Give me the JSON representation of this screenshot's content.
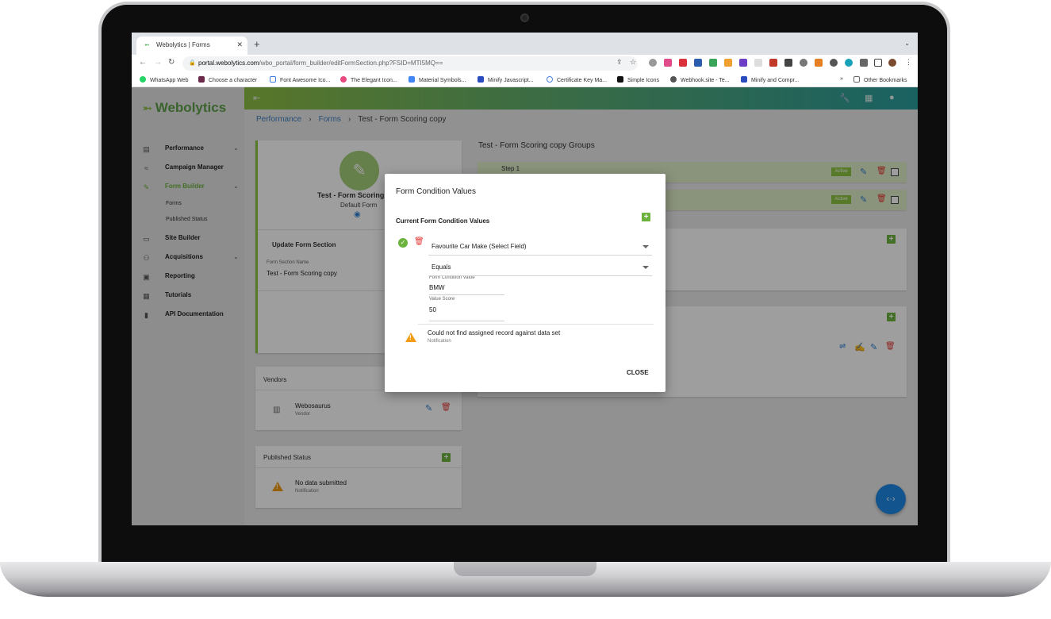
{
  "browser": {
    "tab_title": "Webolytics | Forms",
    "url_host": "portal.webolytics.com",
    "url_path": "/wbo_portal/form_builder/editFormSection.php?FSID=MTI5MQ==",
    "bookmarks": [
      "WhatsApp Web",
      "Choose a character",
      "Font Awesome Ico...",
      "The Elegant Icon...",
      "Material Symbols...",
      "Minify Javascript...",
      "Certificate Key Ma...",
      "Simple Icons",
      "Webhook.site - Te...",
      "Minify and Compr..."
    ],
    "more_bookmarks": "»",
    "other_bookmarks": "Other Bookmarks"
  },
  "app": {
    "logo": "Webolytics",
    "nav": {
      "performance": "Performance",
      "campaign_manager": "Campaign Manager",
      "form_builder": "Form Builder",
      "forms": "Forms",
      "published_status": "Published Status",
      "site_builder": "Site Builder",
      "acquisitions": "Acquisitions",
      "reporting": "Reporting",
      "tutorials": "Tutorials",
      "api_documentation": "API Documentation"
    },
    "breadcrumb": [
      "Performance",
      "Forms",
      "Test - Form Scoring copy"
    ],
    "form_card": {
      "title": "Test - Form Scoring copy",
      "subtitle": "Default Form"
    },
    "update_section": {
      "title": "Update Form Section",
      "field_label": "Form Section Name",
      "field_value": "Test - Form Scoring copy"
    },
    "vendors": {
      "title": "Vendors",
      "name": "Webosaurus",
      "role": "Vendor"
    },
    "published_status": {
      "title": "Published Status",
      "message": "No data submitted",
      "caption": "Notification"
    },
    "groups": {
      "title": "Test - Form Scoring copy Groups",
      "step_label": "Step 1",
      "badge": "Active"
    }
  },
  "dialog": {
    "title": "Form Condition Values",
    "subtitle": "Current Form Condition Values",
    "field_select": "Favourite Car Make (Select Field)",
    "operator_select": "Equals",
    "value_label": "Form Condition Value",
    "value": "BMW",
    "score_label": "Value Score",
    "score": "50",
    "warning_message": "Could not find assigned record against data set",
    "warning_caption": "Notification",
    "close_label": "CLOSE"
  },
  "colors": {
    "brand_green": "#6cb33e",
    "link_blue": "#3f7fbf",
    "delete_red": "#e53935",
    "warning_orange": "#f39c12",
    "fab_blue": "#1e88e5"
  },
  "icons": [
    "arrow-left-icon",
    "wrench-icon",
    "dashboard-icon",
    "person-icon",
    "eye-icon",
    "edit-icon",
    "delete-icon",
    "check-circle-icon",
    "warning-icon",
    "code-icon"
  ]
}
